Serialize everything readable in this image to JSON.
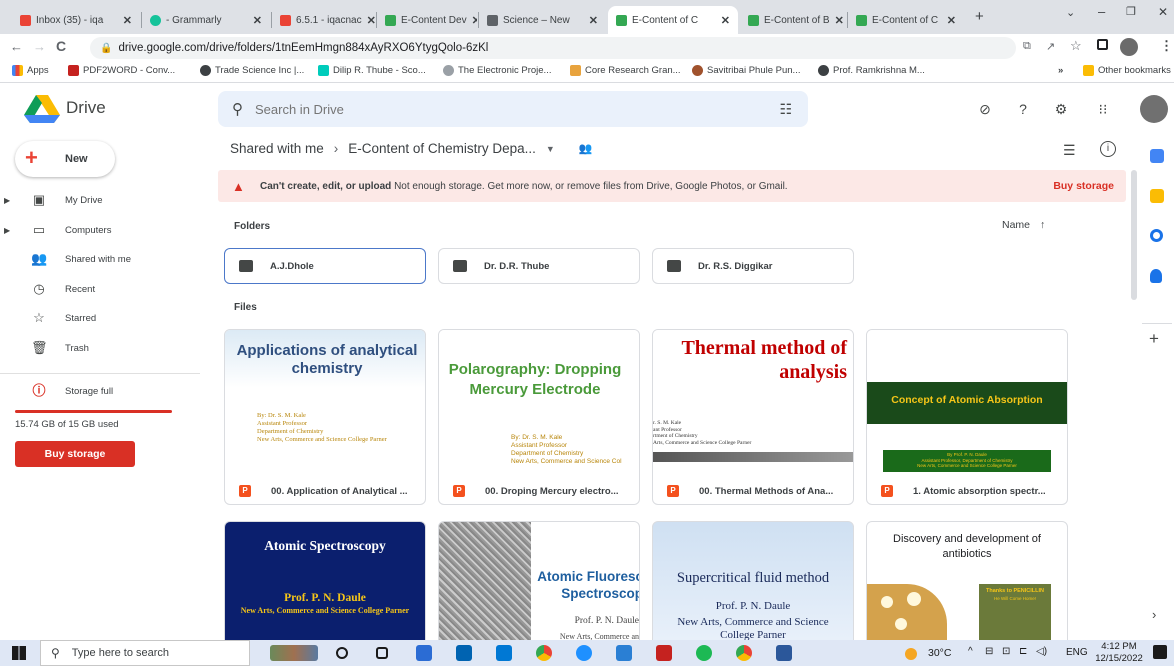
{
  "browser": {
    "tabs": [
      {
        "title": "Inbox (35) - iqa",
        "color": "#ea4335"
      },
      {
        "title": "- Grammarly",
        "color": "#15c39a"
      },
      {
        "title": "6.5.1 - iqacnac",
        "color": "#ea4335"
      },
      {
        "title": "E-Content Dev",
        "color": "#34a853"
      },
      {
        "title": "Science – New",
        "color": "#5f6368"
      },
      {
        "title": "E-Content of C",
        "color": "#34a853"
      },
      {
        "title": "E-Content of B",
        "color": "#34a853"
      },
      {
        "title": "E-Content of C",
        "color": "#34a853"
      }
    ],
    "url": "drive.google.com/drive/folders/1tnEemHmgn884xAyRXO6YtygQolo-6zKl",
    "bookmarks": [
      "Apps",
      "PDF2WORD - Conv...",
      "Trade Science Inc |...",
      "Dilip R. Thube - Sco...",
      "The Electronic Proje...",
      "Core Research Gran...",
      "Savitribai Phule Pun...",
      "Prof. Ramkrishna M..."
    ],
    "other_bookmarks": "Other bookmarks"
  },
  "drive": {
    "logo": "Drive",
    "search_placeholder": "Search in Drive"
  },
  "sidebar": {
    "new_label": "New",
    "items": [
      {
        "label": "My Drive",
        "icon": "my-drive-icon"
      },
      {
        "label": "Computers",
        "icon": "computers-icon"
      },
      {
        "label": "Shared with me",
        "icon": "shared-icon"
      },
      {
        "label": "Recent",
        "icon": "clock-icon"
      },
      {
        "label": "Starred",
        "icon": "star-icon"
      },
      {
        "label": "Trash",
        "icon": "trash-icon"
      }
    ],
    "storage_label": "Storage full",
    "storage_used": "15.74 GB of 15 GB used",
    "storage_fraction": 1.0,
    "buy_storage": "Buy storage"
  },
  "main": {
    "breadcrumb_root": "Shared with me",
    "breadcrumb_current": "E-Content of Chemistry Depa...",
    "warning_bold": "Can't create, edit, or upload",
    "warning_text": "Not enough storage. Get more now, or remove files from Drive, Google Photos, or Gmail.",
    "warning_action": "Buy storage",
    "folders_heading": "Folders",
    "sort_label": "Name",
    "files_heading": "Files",
    "folders": [
      "A.J.Dhole",
      "Dr. D.R. Thube",
      "Dr. R.S. Diggikar"
    ],
    "files": [
      {
        "name": "00. Application of Analytical ...",
        "thumb_title": "Applications of analytical chemistry",
        "thumb_sub": "By: Dr. S. M. Kale\nAssistant Professor\nDepartment of Chemistry\nNew Arts, Commerce and Science College Parner"
      },
      {
        "name": "00. Droping Mercury electro...",
        "thumb_title": "Polarography: Dropping Mercury Electrode",
        "thumb_sub": "By: Dr. S. M. Kale\nAssistant Professor\nDepartment of Chemistry\nNew Arts, Commerce and Science Col"
      },
      {
        "name": "00. Thermal Methods of Ana...",
        "thumb_title": "Thermal method of analysis",
        "thumb_sub": "r. S. M. Kale\nant Professor\nrtment of Chemistry\nArts, Commerce and Science College Parner"
      },
      {
        "name": "1. Atomic absorption spectr...",
        "thumb_title": "Concept of Atomic Absorption",
        "thumb_sub": "By Prof. P. N. Daule\nAssistant Professor, Department of Chemistry\nNew Arts, Commerce and Science College Parner"
      }
    ],
    "files_row2": [
      {
        "thumb_title": "Atomic Spectroscopy",
        "thumb_sub": "Prof. P. N. Daule",
        "thumb_sub2": "New Arts, Commerce and Science College Parner"
      },
      {
        "thumb_title": "Atomic Fluoresc Spectroscop",
        "thumb_sub": "Prof. P. N. Daule",
        "thumb_sub2": "New Arts, Commerce an"
      },
      {
        "thumb_title": "Supercritical fluid method",
        "thumb_sub": "Prof. P. N. Daule",
        "thumb_sub2": "New Arts, Commerce and Science College Parner"
      },
      {
        "thumb_title": "Discovery and development of antibiotics",
        "thumb_sub": "Thanks to PENICILLIN",
        "thumb_sub2": "He Will Come Home!"
      }
    ]
  },
  "taskbar": {
    "search_placeholder": "Type here to search",
    "weather": "30°C",
    "lang": "ENG",
    "time": "4:12 PM",
    "date": "12/15/2022"
  }
}
